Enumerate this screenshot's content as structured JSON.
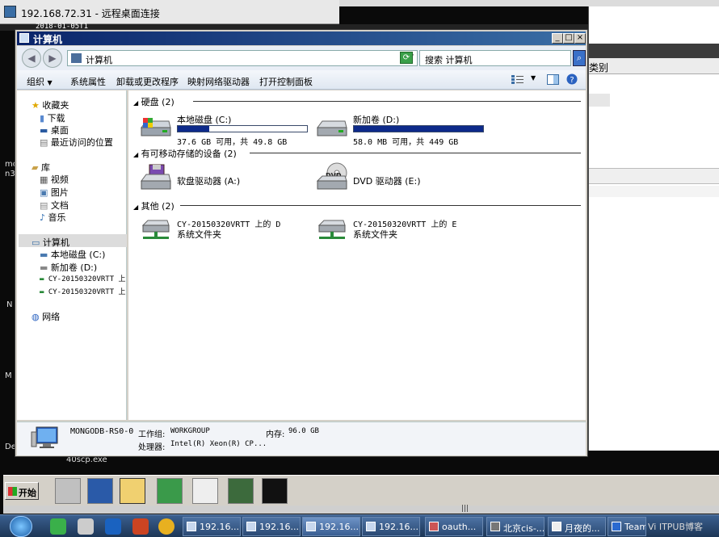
{
  "rdp": {
    "title": "192.168.72.31 - 远程桌面连接",
    "clock_fragment": "2018-01-05T1"
  },
  "background_window": {
    "column_header": "类别"
  },
  "desktop_labels": [
    "mo",
    "n3",
    "N",
    "M",
    "De",
    "40scp.exe"
  ],
  "window": {
    "title": "计算机",
    "controls": [
      "_",
      "□",
      "×"
    ],
    "address": "计算机",
    "search_placeholder": "搜索 计算机"
  },
  "command_bar": {
    "organize": "组织",
    "system_properties": "系统属性",
    "uninstall": "卸载或更改程序",
    "map_drive": "映射网络驱动器",
    "control_panel": "打开控制面板"
  },
  "nav": {
    "favorites": "收藏夹",
    "downloads": "下载",
    "desktop": "桌面",
    "recent": "最近访问的位置",
    "libraries": "库",
    "videos": "视频",
    "pictures": "图片",
    "documents": "文档",
    "music": "音乐",
    "computer": "计算机",
    "local_c": "本地磁盘 (C:)",
    "new_d": "新加卷 (D:)",
    "net_d": "CY-20150320VRTT 上",
    "net_e": "CY-20150320VRTT 上",
    "network": "网络"
  },
  "groups": {
    "hard_disks": "硬盘 (2)",
    "removable": "有可移动存储的设备 (2)",
    "other": "其他 (2)"
  },
  "drives": {
    "c": {
      "name": "本地磁盘 (C:)",
      "free": "37.6 GB 可用，共 49.8 GB",
      "used_fraction": 0.245
    },
    "d": {
      "name": "新加卷 (D:)",
      "free": "58.0 MB 可用，共 449 GB",
      "used_fraction": 0.9999
    },
    "floppy": {
      "name": "软盘驱动器 (A:)"
    },
    "dvd": {
      "name": "DVD 驱动器 (E:)"
    },
    "net_d": {
      "name": "CY-20150320VRTT 上的 D",
      "sub": "系统文件夹"
    },
    "net_e": {
      "name": "CY-20150320VRTT 上的 E",
      "sub": "系统文件夹"
    }
  },
  "details": {
    "computer_name": "MONGODB-RS0-0",
    "workgroup_label": "工作组:",
    "workgroup": "WORKGROUP",
    "memory_label": "内存:",
    "memory": "96.0 GB",
    "processor_label": "处理器:",
    "processor": "Intel(R) Xeon(R) CP..."
  },
  "remote_taskbar": {
    "start": "开始"
  },
  "local_taskbar": {
    "items": [
      {
        "label": "192.16..."
      },
      {
        "label": "192.16..."
      },
      {
        "label": "192.16..."
      },
      {
        "label": "192.16..."
      },
      {
        "label": "oauth..."
      },
      {
        "label": "北京cis-..."
      },
      {
        "label": "月夜的..."
      },
      {
        "label": "Team..."
      }
    ],
    "tray_text": "Vi ITPUB博客"
  }
}
